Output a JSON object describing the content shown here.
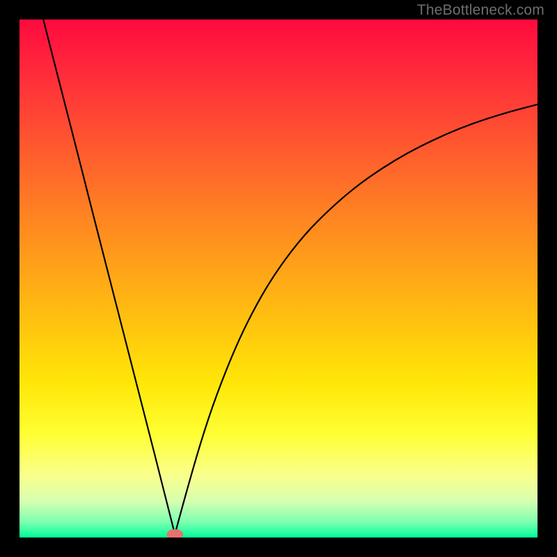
{
  "watermark": "TheBottleneck.com",
  "chart_data": {
    "type": "line",
    "title": "",
    "xlabel": "",
    "ylabel": "",
    "xlim": [
      0,
      100
    ],
    "ylim": [
      0,
      100
    ],
    "gradient_stops": [
      {
        "offset": 0.0,
        "color": "#ff0a3f"
      },
      {
        "offset": 0.1,
        "color": "#ff2a3b"
      },
      {
        "offset": 0.25,
        "color": "#ff5a2e"
      },
      {
        "offset": 0.4,
        "color": "#ff8a20"
      },
      {
        "offset": 0.55,
        "color": "#ffb812"
      },
      {
        "offset": 0.7,
        "color": "#ffe607"
      },
      {
        "offset": 0.8,
        "color": "#ffff33"
      },
      {
        "offset": 0.88,
        "color": "#faff8c"
      },
      {
        "offset": 0.93,
        "color": "#d6ffb0"
      },
      {
        "offset": 0.97,
        "color": "#7dffb0"
      },
      {
        "offset": 1.0,
        "color": "#00ff99"
      }
    ],
    "series": [
      {
        "name": "left-branch",
        "x": [
          4.6,
          6.0,
          8.0,
          10.0,
          12.0,
          14.0,
          16.0,
          18.0,
          20.0,
          22.0,
          24.0,
          26.0,
          28.0,
          29.9
        ],
        "y": [
          100.0,
          94.5,
          86.7,
          78.9,
          71.1,
          63.2,
          55.4,
          47.6,
          39.8,
          32.0,
          24.2,
          16.4,
          8.5,
          1.0
        ]
      },
      {
        "name": "right-branch",
        "x": [
          30.1,
          32.0,
          35.0,
          38.0,
          42.0,
          46.0,
          50.0,
          55.0,
          60.0,
          65.0,
          70.0,
          75.0,
          80.0,
          85.0,
          90.0,
          95.0,
          100.0
        ],
        "y": [
          1.0,
          8.0,
          18.5,
          27.5,
          37.5,
          45.5,
          52.0,
          58.5,
          63.5,
          67.8,
          71.3,
          74.3,
          76.8,
          79.0,
          80.8,
          82.3,
          83.6
        ]
      }
    ],
    "marker": {
      "x": 30.0,
      "y": 0.6,
      "color": "#e5736f",
      "rx": 1.6,
      "ry": 1.0
    },
    "curve_stroke": "#000000",
    "curve_width": 2.2
  }
}
